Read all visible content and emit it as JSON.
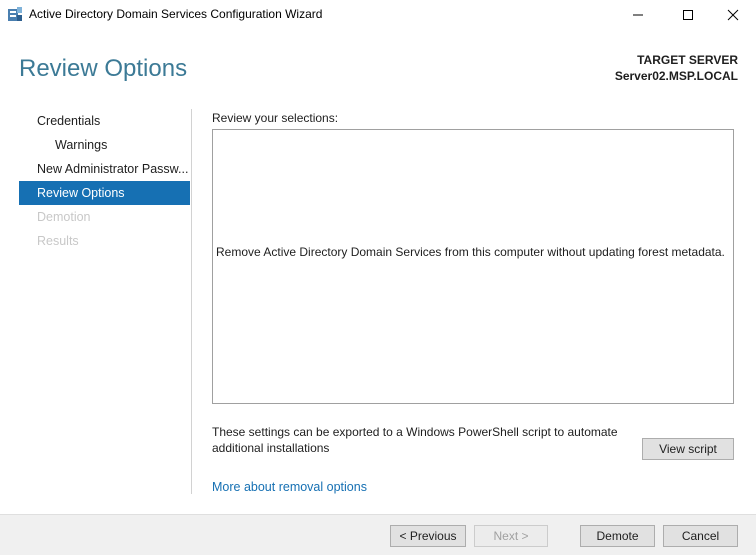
{
  "window": {
    "title": "Active Directory Domain Services Configuration Wizard",
    "icon": "server-manager-icon",
    "controls": {
      "minimize": "minimize-icon",
      "maximize": "maximize-icon",
      "close": "close-icon"
    }
  },
  "header": {
    "title": "Review Options",
    "target_label": "TARGET SERVER",
    "target_value": "Server02.MSP.LOCAL"
  },
  "nav": {
    "items": [
      {
        "label": "Credentials",
        "state": "normal"
      },
      {
        "label": "Warnings",
        "state": "sub"
      },
      {
        "label": "New Administrator Passw...",
        "state": "normal"
      },
      {
        "label": "Review Options",
        "state": "active"
      },
      {
        "label": "Demotion",
        "state": "disabled"
      },
      {
        "label": "Results",
        "state": "disabled"
      }
    ]
  },
  "main": {
    "review_label": "Review your selections:",
    "review_text": "Remove Active Directory Domain Services from this computer without updating forest metadata.",
    "export_text": "These settings can be exported to a Windows PowerShell script to automate additional installations",
    "view_script_label": "View script",
    "more_link": "More about removal options"
  },
  "footer": {
    "previous_label": "< Previous",
    "next_label": "Next >",
    "demote_label": "Demote",
    "cancel_label": "Cancel"
  },
  "colors": {
    "accent": "#1670b3",
    "header_title": "#3c7a96",
    "disabled_text": "#c8c8c8",
    "footer_bg": "#f0f0f0"
  }
}
